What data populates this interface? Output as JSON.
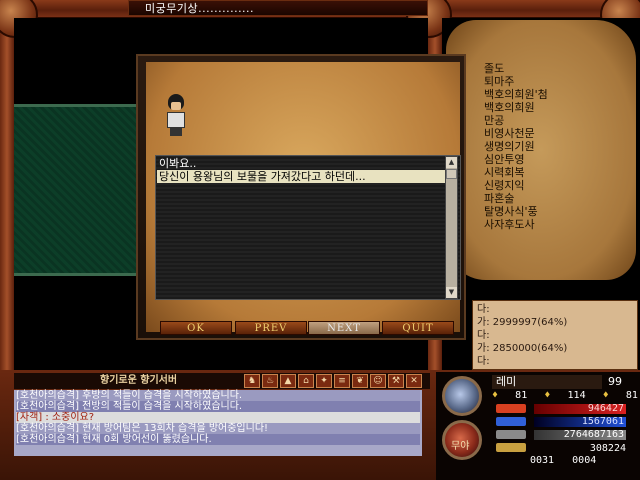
{
  "window": {
    "title": "미궁무기상.............."
  },
  "skills": [
    "졸도",
    "퇴마주",
    "백호의희원'첨",
    "백호의희원",
    "만공",
    "비영사천문",
    "생명의기원",
    "심안투영",
    "시력회복",
    "신령지익",
    "파혼술",
    "탈명사식'풍",
    "사자후도사"
  ],
  "info": {
    "lines": [
      "다:",
      "가: 2999997(64%)",
      "다:",
      "가: 2850000(64%)",
      "다:"
    ]
  },
  "dialog": {
    "lines": [
      "이봐요..",
      "당신이 용왕님의 보물을 가져갔다고 하던데..."
    ],
    "buttons": {
      "ok": "OK",
      "prev": "PREV",
      "next": "NEXT",
      "quit": "QUIT"
    }
  },
  "chat": {
    "title": "향기로운 향기서버",
    "lines": [
      "[호천아의습격] 후방의 적들이 습격을 시작하였습니다.",
      "[호천아의습격] 전방의 적들이 습격을 시작하였습니다.",
      "[자객] : 소중이요?",
      "[호천아의습격] 현재 방어팀은 13회차 습격을 방어중입니다!",
      "[호천아의습격] 현재 0회 방어선이 뚫렸습니다."
    ]
  },
  "status": {
    "name": "레미",
    "level": "99",
    "str": "81",
    "int": "114",
    "dex": "81",
    "hp": "946427",
    "mp": "1567061",
    "exp": "2764687163",
    "gold": "308224",
    "pos_x": "0031",
    "pos_y": "0004",
    "orb_label": "무야"
  },
  "colors": {
    "hp": "#d82020",
    "mp": "#2050d8",
    "exp": "#e8e8e8"
  }
}
